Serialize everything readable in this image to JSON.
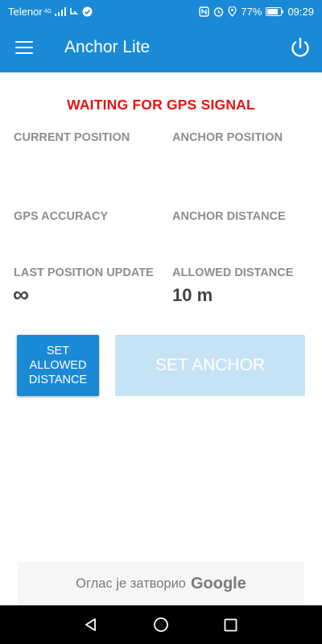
{
  "status_bar": {
    "carrier": "Telenor",
    "network": "4G",
    "battery": "77%",
    "time": "09:29"
  },
  "app_bar": {
    "title": "Anchor Lite",
    "menu_icon": "hamburger-menu-icon",
    "power_icon": "power-icon"
  },
  "status_message": "WAITING FOR GPS SIGNAL",
  "fields": {
    "current_position": {
      "label": "CURRENT POSITION",
      "value": ""
    },
    "anchor_position": {
      "label": "ANCHOR POSITION",
      "value": ""
    },
    "gps_accuracy": {
      "label": "GPS ACCURACY",
      "value": ""
    },
    "anchor_distance": {
      "label": "ANCHOR DISTANCE",
      "value": ""
    },
    "last_position_update": {
      "label": "LAST POSITION UPDATE",
      "value": "∞"
    },
    "allowed_distance": {
      "label": "ALLOWED DISTANCE",
      "value": "10 m"
    }
  },
  "buttons": {
    "set_allowed_distance": "SET\nALLOWED\nDISTANCE",
    "set_anchor": "SET ANCHOR"
  },
  "ad": {
    "text": "Оглас је затворио",
    "brand": "Google"
  },
  "colors": {
    "primary": "#1a8ad6",
    "warning": "#e31515",
    "disabled_button": "#c6e3f5"
  }
}
